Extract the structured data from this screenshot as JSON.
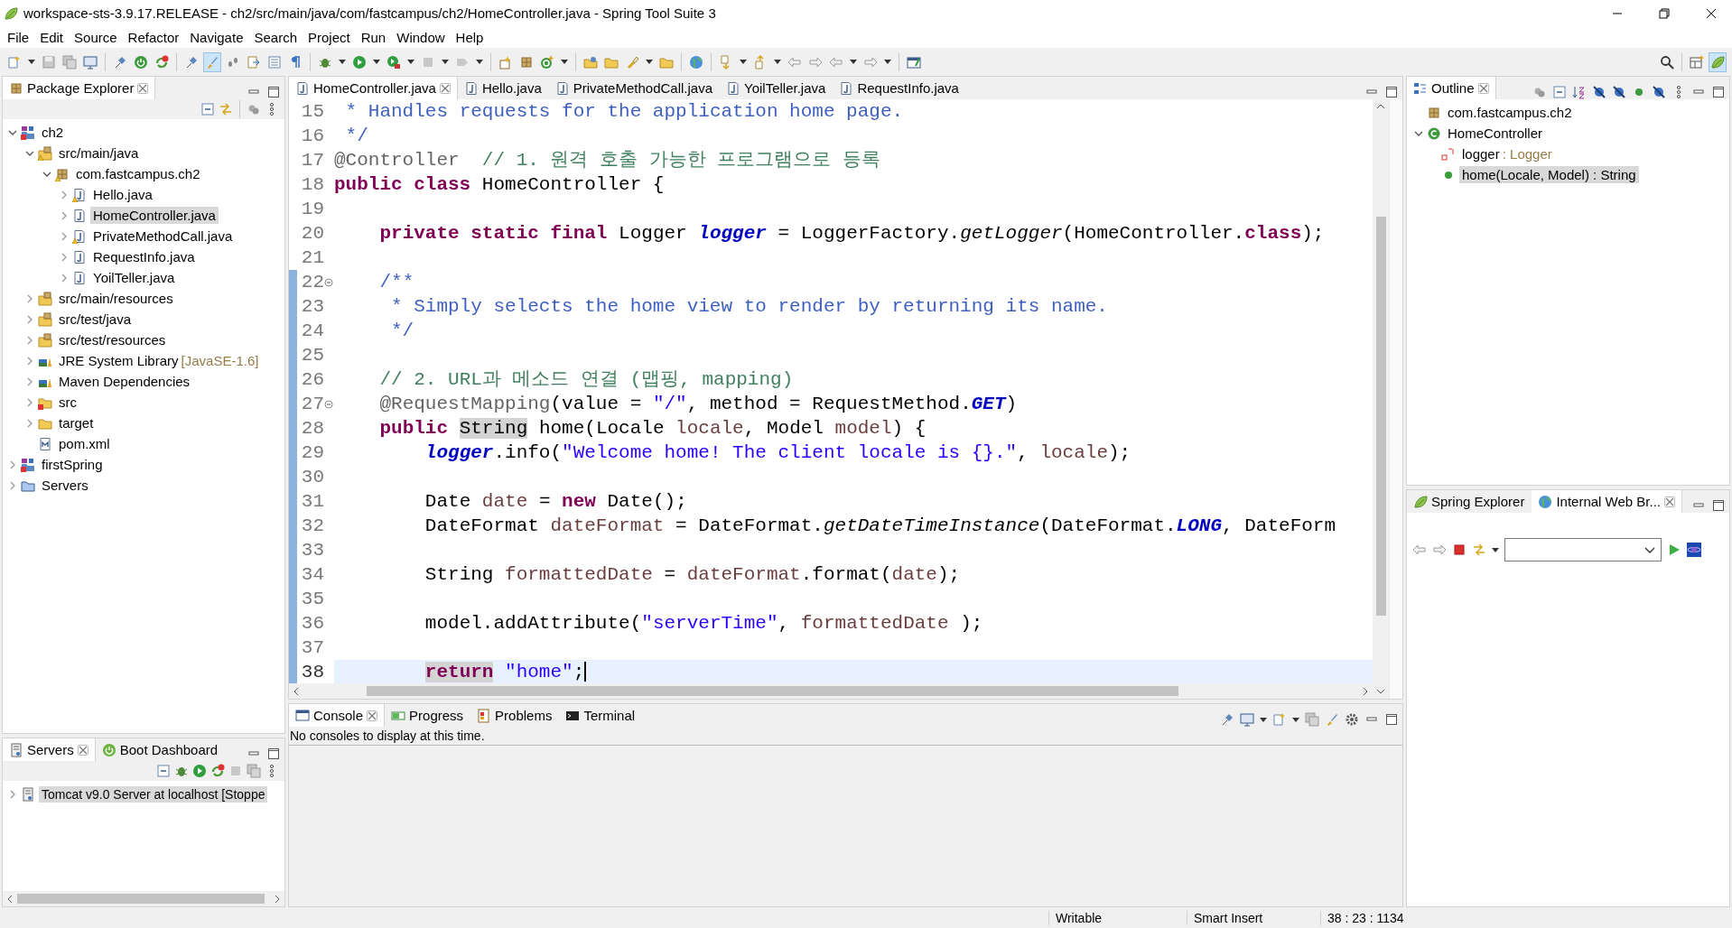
{
  "window": {
    "title": "workspace-sts-3.9.17.RELEASE - ch2/src/main/java/com/fastcampus/ch2/HomeController.java - Spring Tool Suite 3"
  },
  "menu": [
    "File",
    "Edit",
    "Source",
    "Refactor",
    "Navigate",
    "Search",
    "Project",
    "Run",
    "Window",
    "Help"
  ],
  "package_explorer": {
    "tabs": [
      {
        "label": "Package Explorer",
        "selected": true
      }
    ],
    "tree": [
      {
        "label": "ch2",
        "kind": "project",
        "warning": false,
        "error": true,
        "expanded": true,
        "selected": false,
        "children": [
          {
            "label": "src/main/java",
            "kind": "source-folder",
            "warning": true,
            "error": false,
            "expanded": true,
            "selected": false,
            "children": [
              {
                "label": "com.fastcampus.ch2",
                "kind": "package",
                "warning": true,
                "error": false,
                "expanded": true,
                "selected": false,
                "children": [
                  {
                    "label": "Hello.java",
                    "kind": "java-file",
                    "warning": true,
                    "error": false,
                    "expanded": false,
                    "selected": false
                  },
                  {
                    "label": "HomeController.java",
                    "kind": "java-file",
                    "warning": false,
                    "error": false,
                    "expanded": false,
                    "selected": true
                  },
                  {
                    "label": "PrivateMethodCall.java",
                    "kind": "java-file",
                    "warning": true,
                    "error": false,
                    "expanded": false,
                    "selected": false
                  },
                  {
                    "label": "RequestInfo.java",
                    "kind": "java-file",
                    "warning": false,
                    "error": false,
                    "expanded": false,
                    "selected": false
                  },
                  {
                    "label": "YoilTeller.java",
                    "kind": "java-file",
                    "warning": false,
                    "error": false,
                    "expanded": false,
                    "selected": false
                  }
                ]
              }
            ]
          },
          {
            "label": "src/main/resources",
            "kind": "source-folder",
            "warning": false,
            "error": false,
            "expanded": false,
            "selected": false
          },
          {
            "label": "src/test/java",
            "kind": "source-folder",
            "warning": false,
            "error": false,
            "expanded": false,
            "selected": false
          },
          {
            "label": "src/test/resources",
            "kind": "source-folder",
            "warning": false,
            "error": false,
            "expanded": false,
            "selected": false
          },
          {
            "label": "JRE System Library",
            "decoration": "[JavaSE-1.6]",
            "kind": "library",
            "warning": false,
            "error": false,
            "expanded": false,
            "selected": false
          },
          {
            "label": "Maven Dependencies",
            "kind": "library",
            "warning": false,
            "error": false,
            "expanded": false,
            "selected": false
          },
          {
            "label": "src",
            "kind": "folder",
            "warning": false,
            "error": true,
            "expanded": false,
            "selected": false
          },
          {
            "label": "target",
            "kind": "folder",
            "warning": false,
            "error": false,
            "expanded": false,
            "selected": false
          },
          {
            "label": "pom.xml",
            "kind": "xml-file",
            "warning": false,
            "error": false,
            "selected": false
          }
        ]
      },
      {
        "label": "firstSpring",
        "kind": "project",
        "warning": false,
        "error": true,
        "expanded": false,
        "selected": false
      },
      {
        "label": "Servers",
        "kind": "servers-folder",
        "warning": false,
        "error": false,
        "expanded": false,
        "selected": false
      }
    ]
  },
  "servers": {
    "tabs": [
      {
        "label": "Servers",
        "selected": true
      },
      {
        "label": "Boot Dashboard",
        "selected": false
      }
    ],
    "items": [
      {
        "label": "Tomcat v9.0 Server at localhost",
        "state": "[Stoppe",
        "expanded": false,
        "selected": true
      }
    ]
  },
  "editor": {
    "tabs": [
      {
        "label": "HomeController.java",
        "selected": true
      },
      {
        "label": "Hello.java",
        "selected": false
      },
      {
        "label": "PrivateMethodCall.java",
        "selected": false
      },
      {
        "label": "YoilTeller.java",
        "selected": false
      },
      {
        "label": "RequestInfo.java",
        "selected": false
      }
    ],
    "lines": [
      {
        "number": "15",
        "fold": false,
        "changed": false,
        "current": false,
        "tokens": [
          {
            "kind": "javadoc",
            "text": " * Handles requests for the application home page."
          }
        ]
      },
      {
        "number": "16",
        "fold": false,
        "changed": false,
        "current": false,
        "tokens": [
          {
            "kind": "javadoc",
            "text": " */"
          }
        ]
      },
      {
        "number": "17",
        "fold": false,
        "changed": false,
        "current": false,
        "tokens": [
          {
            "kind": "annotation",
            "text": "@Controller"
          },
          {
            "kind": "comment",
            "text": "  // 1. 원격 호출 가능한 프로그램으로 등록"
          }
        ]
      },
      {
        "number": "18",
        "fold": false,
        "changed": false,
        "current": false,
        "tokens": [
          {
            "kind": "keyword",
            "text": "public class "
          },
          {
            "kind": "plain",
            "text": "HomeController {"
          }
        ]
      },
      {
        "number": "19",
        "fold": false,
        "changed": false,
        "current": false
      },
      {
        "number": "20",
        "fold": false,
        "changed": false,
        "current": false,
        "tokens": [
          {
            "kind": "keyword",
            "text": "    private static final "
          },
          {
            "kind": "plain",
            "text": "Logger "
          },
          {
            "kind": "field",
            "text": "logger"
          },
          {
            "kind": "plain",
            "text": " = LoggerFactory."
          },
          {
            "kind": "static",
            "text": "getLogger"
          },
          {
            "kind": "plain",
            "text": "(HomeController."
          },
          {
            "kind": "keyword",
            "text": "class"
          },
          {
            "kind": "plain",
            "text": ");"
          }
        ]
      },
      {
        "number": "21",
        "fold": false,
        "changed": false,
        "current": false
      },
      {
        "number": "22",
        "fold": true,
        "changed": true,
        "current": false,
        "tokens": [
          {
            "kind": "javadoc",
            "text": "    /**"
          }
        ]
      },
      {
        "number": "23",
        "fold": false,
        "changed": true,
        "current": false,
        "tokens": [
          {
            "kind": "javadoc",
            "text": "     * Simply selects the home view to render by returning its name."
          }
        ]
      },
      {
        "number": "24",
        "fold": false,
        "changed": true,
        "current": false,
        "tokens": [
          {
            "kind": "javadoc",
            "text": "     */"
          }
        ]
      },
      {
        "number": "25",
        "fold": false,
        "changed": true,
        "current": false
      },
      {
        "number": "26",
        "fold": false,
        "changed": true,
        "current": false,
        "tokens": [
          {
            "kind": "comment",
            "text": "    // 2. URL과 메소드 연결 (맵핑, mapping)"
          }
        ]
      },
      {
        "number": "27",
        "fold": true,
        "changed": true,
        "current": false,
        "tokens": [
          {
            "kind": "annotation",
            "text": "    @RequestMapping"
          },
          {
            "kind": "plain",
            "text": "(value = "
          },
          {
            "kind": "string",
            "text": "\"/\""
          },
          {
            "kind": "plain",
            "text": ", method = RequestMethod."
          },
          {
            "kind": "constant",
            "text": "GET"
          },
          {
            "kind": "plain",
            "text": ")"
          }
        ]
      },
      {
        "number": "28",
        "fold": false,
        "changed": true,
        "current": false,
        "tokens": [
          {
            "kind": "keyword",
            "text": "    public "
          },
          {
            "kind": "plain",
            "text": "String",
            "highlighted": true
          },
          {
            "kind": "plain",
            "text": " home(Locale "
          },
          {
            "kind": "local",
            "text": "locale"
          },
          {
            "kind": "plain",
            "text": ", Model "
          },
          {
            "kind": "local",
            "text": "model"
          },
          {
            "kind": "plain",
            "text": ") {"
          }
        ]
      },
      {
        "number": "29",
        "fold": false,
        "changed": true,
        "current": false,
        "tokens": [
          {
            "kind": "field",
            "text": "        logger"
          },
          {
            "kind": "plain",
            "text": ".info("
          },
          {
            "kind": "string",
            "text": "\"Welcome home! The client locale is {}.\""
          },
          {
            "kind": "plain",
            "text": ", "
          },
          {
            "kind": "local",
            "text": "locale"
          },
          {
            "kind": "plain",
            "text": ");"
          }
        ]
      },
      {
        "number": "30",
        "fold": false,
        "changed": true,
        "current": false
      },
      {
        "number": "31",
        "fold": false,
        "changed": true,
        "current": false,
        "tokens": [
          {
            "kind": "plain",
            "text": "        Date "
          },
          {
            "kind": "local",
            "text": "date"
          },
          {
            "kind": "plain",
            "text": " = "
          },
          {
            "kind": "keyword",
            "text": "new "
          },
          {
            "kind": "plain",
            "text": "Date();"
          }
        ]
      },
      {
        "number": "32",
        "fold": false,
        "changed": true,
        "current": false,
        "tokens": [
          {
            "kind": "plain",
            "text": "        DateFormat "
          },
          {
            "kind": "local",
            "text": "dateFormat"
          },
          {
            "kind": "plain",
            "text": " = DateFormat."
          },
          {
            "kind": "static",
            "text": "getDateTimeInstance"
          },
          {
            "kind": "plain",
            "text": "(DateFormat."
          },
          {
            "kind": "constant",
            "text": "LONG"
          },
          {
            "kind": "plain",
            "text": ", DateForm"
          }
        ]
      },
      {
        "number": "33",
        "fold": false,
        "changed": true,
        "current": false
      },
      {
        "number": "34",
        "fold": false,
        "changed": true,
        "current": false,
        "tokens": [
          {
            "kind": "plain",
            "text": "        String "
          },
          {
            "kind": "local",
            "text": "formattedDate"
          },
          {
            "kind": "plain",
            "text": " = "
          },
          {
            "kind": "local",
            "text": "dateFormat"
          },
          {
            "kind": "plain",
            "text": ".format("
          },
          {
            "kind": "local",
            "text": "date"
          },
          {
            "kind": "plain",
            "text": ");"
          }
        ]
      },
      {
        "number": "35",
        "fold": false,
        "changed": true,
        "current": false
      },
      {
        "number": "36",
        "fold": false,
        "changed": true,
        "current": false,
        "tokens": [
          {
            "kind": "plain",
            "text": "        model.addAttribute("
          },
          {
            "kind": "string",
            "text": "\"serverTime\""
          },
          {
            "kind": "plain",
            "text": ", "
          },
          {
            "kind": "local",
            "text": "formattedDate"
          },
          {
            "kind": "plain",
            "text": " );"
          }
        ]
      },
      {
        "number": "37",
        "fold": false,
        "changed": true,
        "current": false
      },
      {
        "number": "38",
        "fold": false,
        "changed": true,
        "current": true,
        "tokens": [
          {
            "kind": "keyword",
            "text": "        return",
            "highlighted": true
          },
          {
            "kind": "string",
            "text": " \"home\""
          },
          {
            "kind": "plain",
            "text": ";"
          }
        ]
      }
    ]
  },
  "console": {
    "tabs": [
      {
        "label": "Console",
        "selected": true
      },
      {
        "label": "Progress",
        "selected": false
      },
      {
        "label": "Problems",
        "selected": false
      },
      {
        "label": "Terminal",
        "selected": false
      }
    ],
    "message": "No consoles to display at this time."
  },
  "outline": {
    "tabs": [
      {
        "label": "Outline",
        "selected": true
      }
    ],
    "items": [
      {
        "label": "com.fastcampus.ch2",
        "kind": "package",
        "selected": false
      },
      {
        "label": "HomeController",
        "kind": "class",
        "expanded": true,
        "selected": false,
        "children": [
          {
            "label": "logger",
            "type": " : Logger",
            "kind": "static-field",
            "selected": false
          },
          {
            "label": "home(Locale, Model) : String",
            "kind": "method",
            "selected": true
          }
        ]
      }
    ]
  },
  "browser": {
    "tabs": [
      {
        "label": "Spring Explorer",
        "selected": false
      },
      {
        "label": "Internal Web Br...",
        "selected": true
      }
    ]
  },
  "status_bar": [
    "Writable",
    "Smart Insert",
    "38 : 23 : 1134"
  ]
}
